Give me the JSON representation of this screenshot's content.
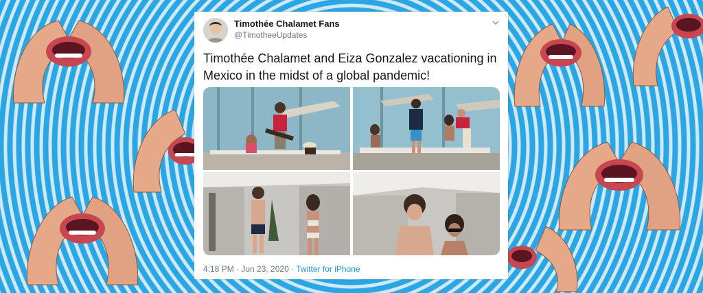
{
  "tweet": {
    "display_name": "Timothée Chalamet Fans",
    "handle": "@TimotheeUpdates",
    "text": "Timothée Chalamet and Eiza Gonzalez vacationing in Mexico in the midst of a global pandemic!",
    "timestamp": "4:18 PM · Jun 23, 2020 ·",
    "source": "Twitter for iPhone",
    "menu_icon": "chevron-down-icon"
  },
  "photos": [
    {
      "name": "photo-poolside-guitar"
    },
    {
      "name": "photo-deck-lounging"
    },
    {
      "name": "photo-balcony-walk"
    },
    {
      "name": "photo-close-up-walk"
    }
  ],
  "colors": {
    "background": "#2aa8e6",
    "name": "#14171a",
    "secondary": "#657786",
    "link": "#1b95e0"
  }
}
